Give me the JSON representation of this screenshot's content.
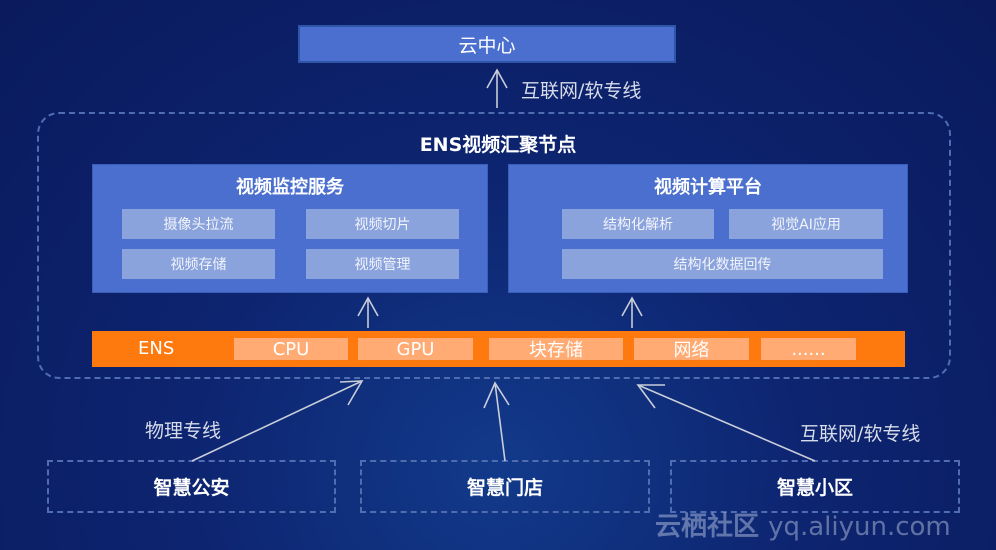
{
  "cloud_center": {
    "label": "云中心"
  },
  "top_link_label": "互联网/软专线",
  "ens_node": {
    "title": "ENS视频汇聚节点",
    "video_monitoring": {
      "title": "视频监控服务",
      "items": [
        "摄像头拉流",
        "视频切片",
        "视频存储",
        "视频管理"
      ]
    },
    "video_compute": {
      "title": "视频计算平台",
      "items": [
        "结构化解析",
        "视觉AI应用",
        "结构化数据回传"
      ]
    },
    "resource_bar": {
      "label": "ENS",
      "items": [
        "CPU",
        "GPU",
        "块存储",
        "网络",
        "......"
      ]
    }
  },
  "left_link_label": "物理专线",
  "right_link_label": "互联网/软专线",
  "sites": [
    "智慧公安",
    "智慧门店",
    "智慧小区"
  ],
  "watermark": {
    "cn": "云栖社区",
    "url": "yq.aliyun.com"
  },
  "colors": {
    "panel": "#4a6fce",
    "chip": "#8aa3dd",
    "bar": "#ff7a0e",
    "bar_item": "#ffab73",
    "background": "#0a1a5c"
  }
}
